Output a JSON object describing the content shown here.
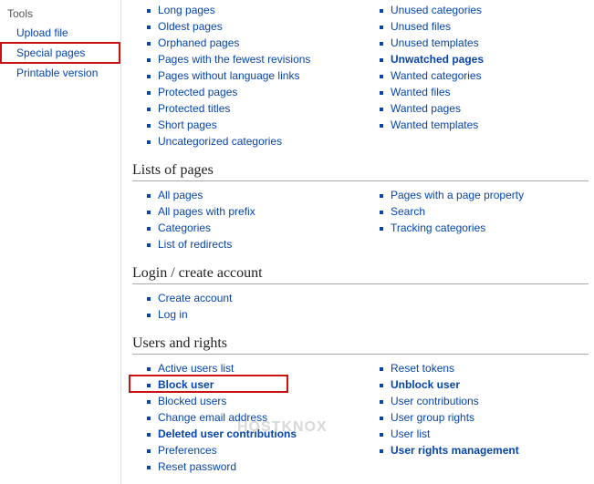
{
  "sidebar": {
    "title": "Tools",
    "items": [
      {
        "label": "Upload file"
      },
      {
        "label": "Special pages",
        "highlighted": true
      },
      {
        "label": "Printable version"
      }
    ]
  },
  "topSection": {
    "left": [
      "Long pages",
      "Oldest pages",
      "Orphaned pages",
      "Pages with the fewest revisions",
      "Pages without language links",
      "Protected pages",
      "Protected titles",
      "Short pages",
      "Uncategorized categories"
    ],
    "right": [
      "Unused categories",
      "Unused files",
      "Unused templates",
      {
        "label": "Unwatched pages",
        "bold": true
      },
      "Wanted categories",
      "Wanted files",
      "Wanted pages",
      "Wanted templates"
    ]
  },
  "sections": [
    {
      "heading": "Lists of pages",
      "left": [
        "All pages",
        "All pages with prefix",
        "Categories",
        "List of redirects"
      ],
      "right": [
        "Pages with a page property",
        "Search",
        "Tracking categories"
      ]
    },
    {
      "heading": "Login / create account",
      "left": [
        "Create account",
        "Log in"
      ],
      "right": []
    },
    {
      "heading": "Users and rights",
      "left": [
        "Active users list",
        {
          "label": "Block user",
          "bold": true,
          "highlighted": true
        },
        "Blocked users",
        "Change email address",
        {
          "label": "Deleted user contributions",
          "bold": true
        },
        "Preferences",
        "Reset password"
      ],
      "right": [
        "Reset tokens",
        {
          "label": "Unblock user",
          "bold": true
        },
        "User contributions",
        "User group rights",
        "User list",
        {
          "label": "User rights management",
          "bold": true
        }
      ]
    }
  ],
  "watermark": "HOSTKNOX"
}
